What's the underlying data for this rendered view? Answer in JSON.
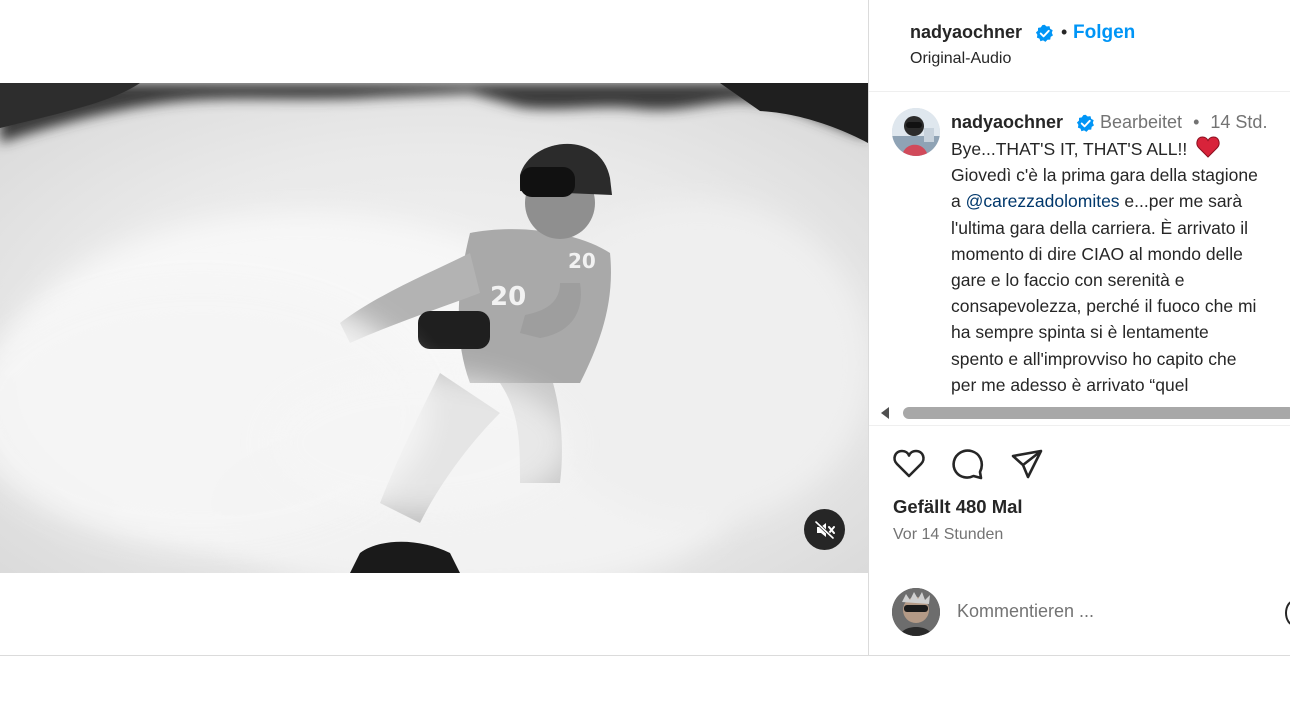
{
  "header": {
    "username": "nadyaochner",
    "dot": "•",
    "follow_label": "Folgen",
    "audio_label": "Original-Audio"
  },
  "caption": {
    "username": "nadyaochner",
    "edited_label": "Bearbeitet",
    "dot": "•",
    "time": "14 Std.",
    "lines": [
      "Bye...THAT'S IT, THAT'S ALL!!",
      "Giovedì c'è la prima gara della stagione",
      "a",
      "@carezzadolomites",
      "e...per me sarà",
      "l'ultima gara della carriera. È arrivato il",
      "momento di dire CIAO al mondo delle",
      "gare e lo faccio con serenità e",
      "consapevolezza, perché il fuoco che mi",
      "ha sempre spinta si è lentamente",
      "spento e all'improvviso ho capito che",
      "per me adesso è arrivato “quel"
    ]
  },
  "stats": {
    "likes": "Gefällt 480 Mal",
    "timestamp": "Vor 14 Stunden"
  },
  "comment_box": {
    "placeholder": "Kommentieren ..."
  },
  "icons": {
    "verified": "verified-badge-icon",
    "heart": "heart-icon",
    "comment": "comment-icon",
    "share": "share-icon",
    "mute": "speaker-muted-icon",
    "caption_heart": "red-heart-emoji"
  },
  "colors": {
    "link_blue": "#0095f6",
    "mention": "#00376b",
    "secondary_text": "#737373",
    "verified": "#0095f6",
    "heart_red": "#d8233a"
  }
}
